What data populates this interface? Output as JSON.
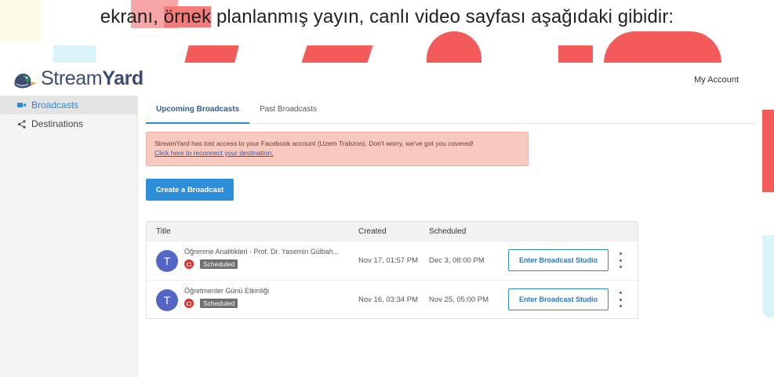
{
  "document": {
    "caption_part1": "ekranı, ",
    "caption_highlight": "örnek",
    "caption_part2": " planlanmış yayın, canlı video sayfası aşağıdaki gibidir:"
  },
  "app": {
    "brand_light": "Stream",
    "brand_bold": "Yard",
    "account_label": "My Account"
  },
  "sidebar": {
    "items": [
      {
        "label": "Broadcasts",
        "icon": "video-camera-icon"
      },
      {
        "label": "Destinations",
        "icon": "share-icon"
      }
    ]
  },
  "tabs": [
    {
      "label": "Upcoming Broadcasts"
    },
    {
      "label": "Past Broadcasts"
    }
  ],
  "alert": {
    "message": "StreamYard has lost access to your Facebook account (Uzem Trabzon). Don't worry, we've got you covered!",
    "link": "Click here to reconnect your destination."
  },
  "create_button": "Create a Broadcast",
  "table": {
    "headers": {
      "title": "Title",
      "created": "Created",
      "scheduled": "Scheduled"
    },
    "rows": [
      {
        "avatar": "T",
        "title": "Öğrenme Analitikleri - Prof. Dr. Yasemin Gülbah...",
        "status": "Scheduled",
        "created": "Nov 17, 01:57 PM",
        "scheduled": "Dec 3, 08:00 PM",
        "action": "Enter Broadcast Studio"
      },
      {
        "avatar": "T",
        "title": "Öğretmenler Günü Etkinliği",
        "status": "Scheduled",
        "created": "Nov 16, 03:34 PM",
        "scheduled": "Nov 25, 05:00 PM",
        "action": "Enter Broadcast Studio"
      }
    ]
  },
  "colors": {
    "accent": "#2e89cf",
    "alert_bg": "#f8c9bf",
    "avatar": "#5366c8",
    "youtube": "#e23131"
  }
}
